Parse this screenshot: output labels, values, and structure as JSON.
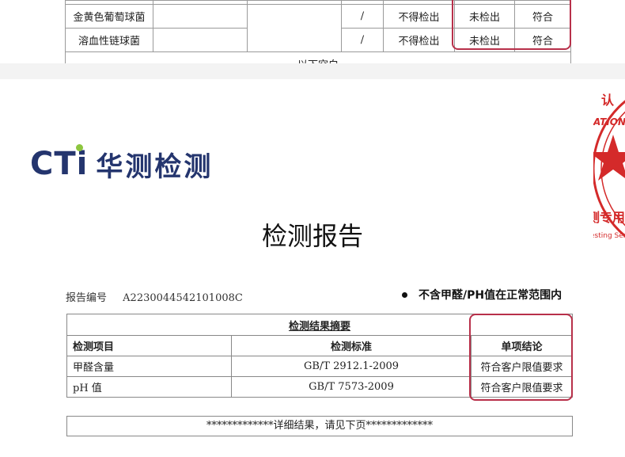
{
  "top_table": {
    "rows": [
      {
        "item": "金黄色葡萄球菌",
        "unit": "/",
        "limit": "不得检出",
        "result": "未检出",
        "verdict": "符合"
      },
      {
        "item": "溶血性链球菌",
        "unit": "/",
        "limit": "不得检出",
        "result": "未检出",
        "verdict": "符合"
      }
    ],
    "blank_note": "以下空白"
  },
  "seal": {
    "char": "认",
    "line1": "ATIONAL",
    "line2": "测专用",
    "line3": "esting Ser",
    "color": "#d42a2a"
  },
  "logo": {
    "mark": "CTi",
    "name": "华测检测"
  },
  "title": "检测报告",
  "report": {
    "label": "报告编号",
    "number": "A2230044542101008C"
  },
  "note": "不含甲醛/PH值在正常范围内",
  "summary": {
    "caption": "检测结果摘要",
    "headers": [
      "检测项目",
      "检测标准",
      "单项结论"
    ],
    "rows": [
      [
        "甲醛含量",
        "GB/T 2912.1-2009",
        "符合客户限值要求"
      ],
      [
        "pH 值",
        "GB/T 7573-2009",
        "符合客户限值要求"
      ]
    ]
  },
  "footer": "*************详细结果，请见下页*************",
  "colors": {
    "highlight": "#b8304a",
    "logo_blue": "#24356e",
    "logo_dot": "#8dc63f"
  }
}
